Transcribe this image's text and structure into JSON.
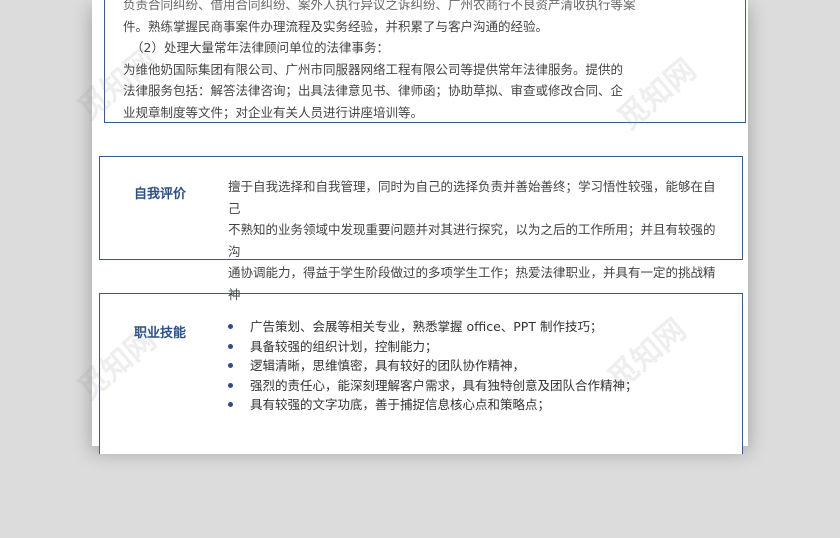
{
  "experience": {
    "line_a": "负责合同纠纷、借用合同纠纷、案外人执行异议之诉纠纷、广州农商行不良资产清收执行等案",
    "line_b": "件。熟练掌握民商事案件办理流程及实务经验，并积累了与客户沟通的经验。",
    "line_c": "（2）处理大量常年法律顾问单位的法律事务：",
    "line_d": "为维他奶国际集团有限公司、广州市同服器网络工程有限公司等提供常年法律服务。提供的",
    "line_e": "法律服务包括：解答法律咨询；出具法律意见书、律师函；协助草拟、审查或修改合同、企",
    "line_f": "业规章制度等文件；对企业有关人员进行讲座培训等。"
  },
  "self_eval": {
    "title": "自我评价",
    "line_a": "擅于自我选择和自我管理，同时为自己的选择负责并善始善终；学习悟性较强，能够在自己",
    "line_b": "不熟知的业务领域中发现重要问题并对其进行探究，以为之后的工作所用；并且有较强的沟",
    "line_c": "通协调能力，得益于学生阶段做过的多项学生工作；热爱法律职业，并具有一定的挑战精神"
  },
  "skills": {
    "title": "职业技能",
    "items": [
      "广告策划、会展等相关专业，熟悉掌握 office、PPT 制作技巧；",
      "具备较强的组织计划，控制能力；",
      "逻辑清晰，思维慎密，具有较好的团队协作精神，",
      "强烈的责任心，能深刻理解客户需求，具有独特创意及团队合作精神；",
      "具有较强的文字功底，善于捕捉信息核心点和策略点；"
    ]
  },
  "watermark": "觅知网"
}
